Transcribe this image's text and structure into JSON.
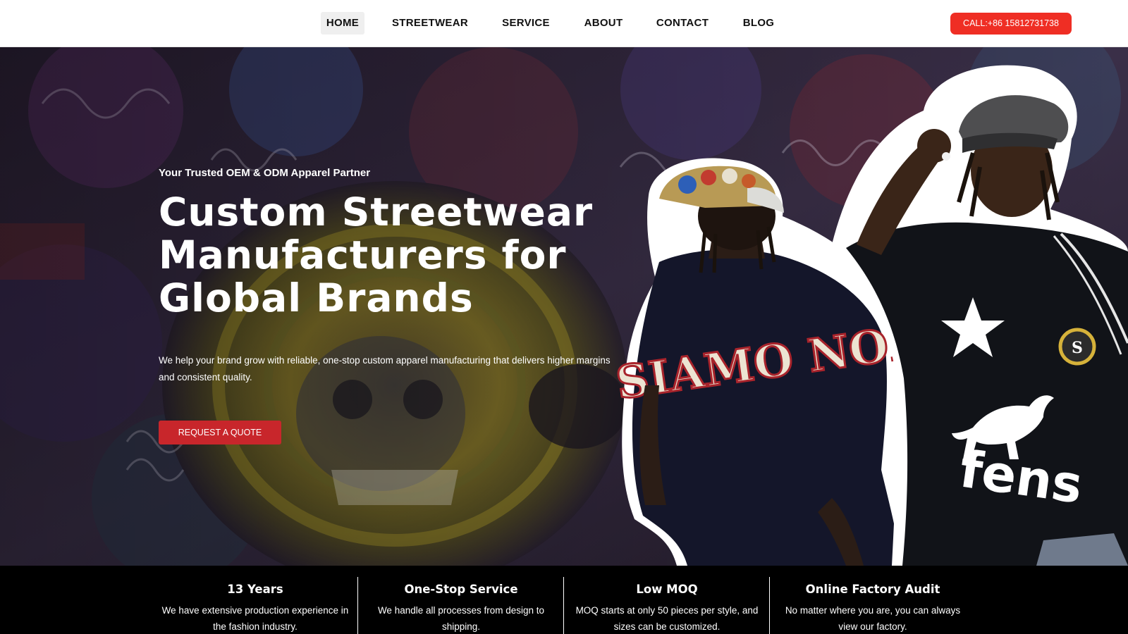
{
  "nav": {
    "items": [
      {
        "label": "HOME",
        "active": true
      },
      {
        "label": "STREETWEAR",
        "active": false
      },
      {
        "label": "SERVICE",
        "active": false
      },
      {
        "label": "ABOUT",
        "active": false
      },
      {
        "label": "CONTACT",
        "active": false
      },
      {
        "label": "BLOG",
        "active": false
      }
    ],
    "call_label": "CALL:+86 15812731738"
  },
  "hero": {
    "eyebrow": "Your Trusted OEM & ODM Apparel Partner",
    "title_lines": [
      "Custom Streetwear",
      "Manufacturers for",
      "Global Brands"
    ],
    "description": "We help your brand grow with reliable, one-stop custom apparel manufacturing that delivers higher margins and consistent quality.",
    "cta_label": "REQUEST A QUOTE",
    "shirt_print_left": "SIAMO NOI",
    "shirt_print_right": "fens"
  },
  "features": [
    {
      "title": "13 Years",
      "description": "We have extensive production experience in the fashion industry."
    },
    {
      "title": "One-Stop Service",
      "description": "We handle all processes from design to shipping."
    },
    {
      "title": "Low MOQ",
      "description": "MOQ starts at only 50 pieces per style, and sizes can be customized."
    },
    {
      "title": "Online Factory Audit",
      "description": "No matter where you are, you can always view our factory."
    }
  ],
  "colors": {
    "accent_red": "#ef2e24",
    "cta_red": "#c8262b",
    "nav_active_bg": "#efefef",
    "features_bg": "#000000"
  }
}
